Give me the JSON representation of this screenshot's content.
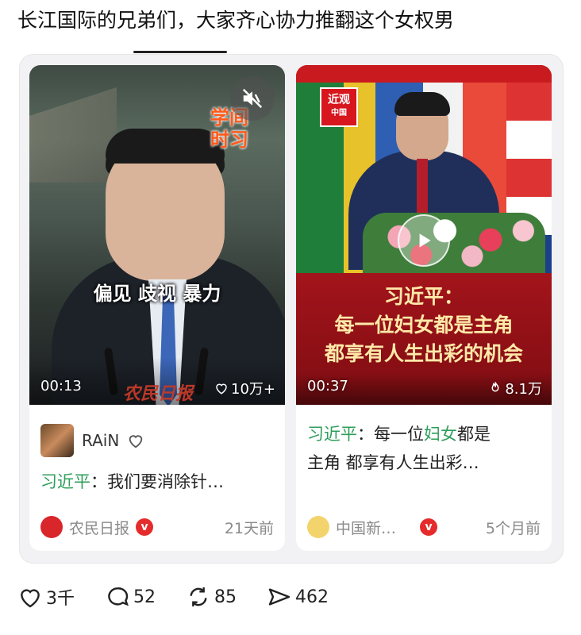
{
  "post": {
    "text": "长江国际的兄弟们，大家齐心协力推翻这个女权男"
  },
  "cards": [
    {
      "video_overlay_caption": "偏见 歧视 暴力",
      "brand_badge_line1": "学间",
      "brand_badge_line2": "时习",
      "watermark": "农民日报",
      "duration": "00:13",
      "likes": "10万+",
      "author": "RAiN",
      "title_highlight": "习近平",
      "title_rest": "：我们要消除针…",
      "source": "农民日报",
      "time": "21天前",
      "verified_mark": "v"
    },
    {
      "headline_line1": "习近平：",
      "headline_line2": "每一位妇女都是主角",
      "headline_line3": "都享有人生出彩的机会",
      "logo_line1": "近观",
      "logo_line2": "中国",
      "duration": "00:37",
      "likes": "8.1万",
      "title_part1_highlight": "习近平",
      "title_part2": "：每一位",
      "title_part3_highlight": "妇女",
      "title_part4": "都是",
      "title_line2": "主角 都享有人生出彩…",
      "source": "中国新…",
      "time": "5个月前",
      "verified_mark": "v"
    }
  ],
  "actions": {
    "likes": "3千",
    "comments": "52",
    "reposts": "85",
    "shares": "462"
  },
  "colors": {
    "highlight_green": "#2e9e5b",
    "verified_red": "#e52b2b",
    "headline_gold": "#ffe9a8"
  }
}
